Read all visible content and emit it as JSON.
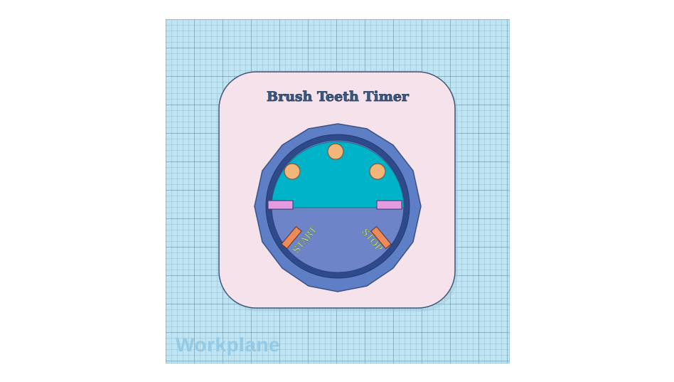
{
  "workplane": {
    "label": "Workplane"
  },
  "model": {
    "title": "Brush Teeth Timer",
    "start_label": "START",
    "stop_label": "STOP"
  },
  "colors": {
    "grid_bg": "#bfe4f4",
    "base_plate": "#f6e2ea",
    "dial_ring": "#5e7fc6",
    "dial_inner": "#6d84c9",
    "cyan_segment": "#00b3c9",
    "peg": "#f2b57a",
    "marker_pink": "#e59be2",
    "marker_orange": "#ee8a59",
    "label_text": "#d4f58e",
    "title_text": "#3a5c86"
  },
  "icons": {
    "pegs": [
      "peg-icon",
      "peg-icon",
      "peg-icon"
    ],
    "markers": [
      "pink-marker-icon",
      "pink-marker-icon",
      "start-marker-icon",
      "stop-marker-icon"
    ]
  }
}
